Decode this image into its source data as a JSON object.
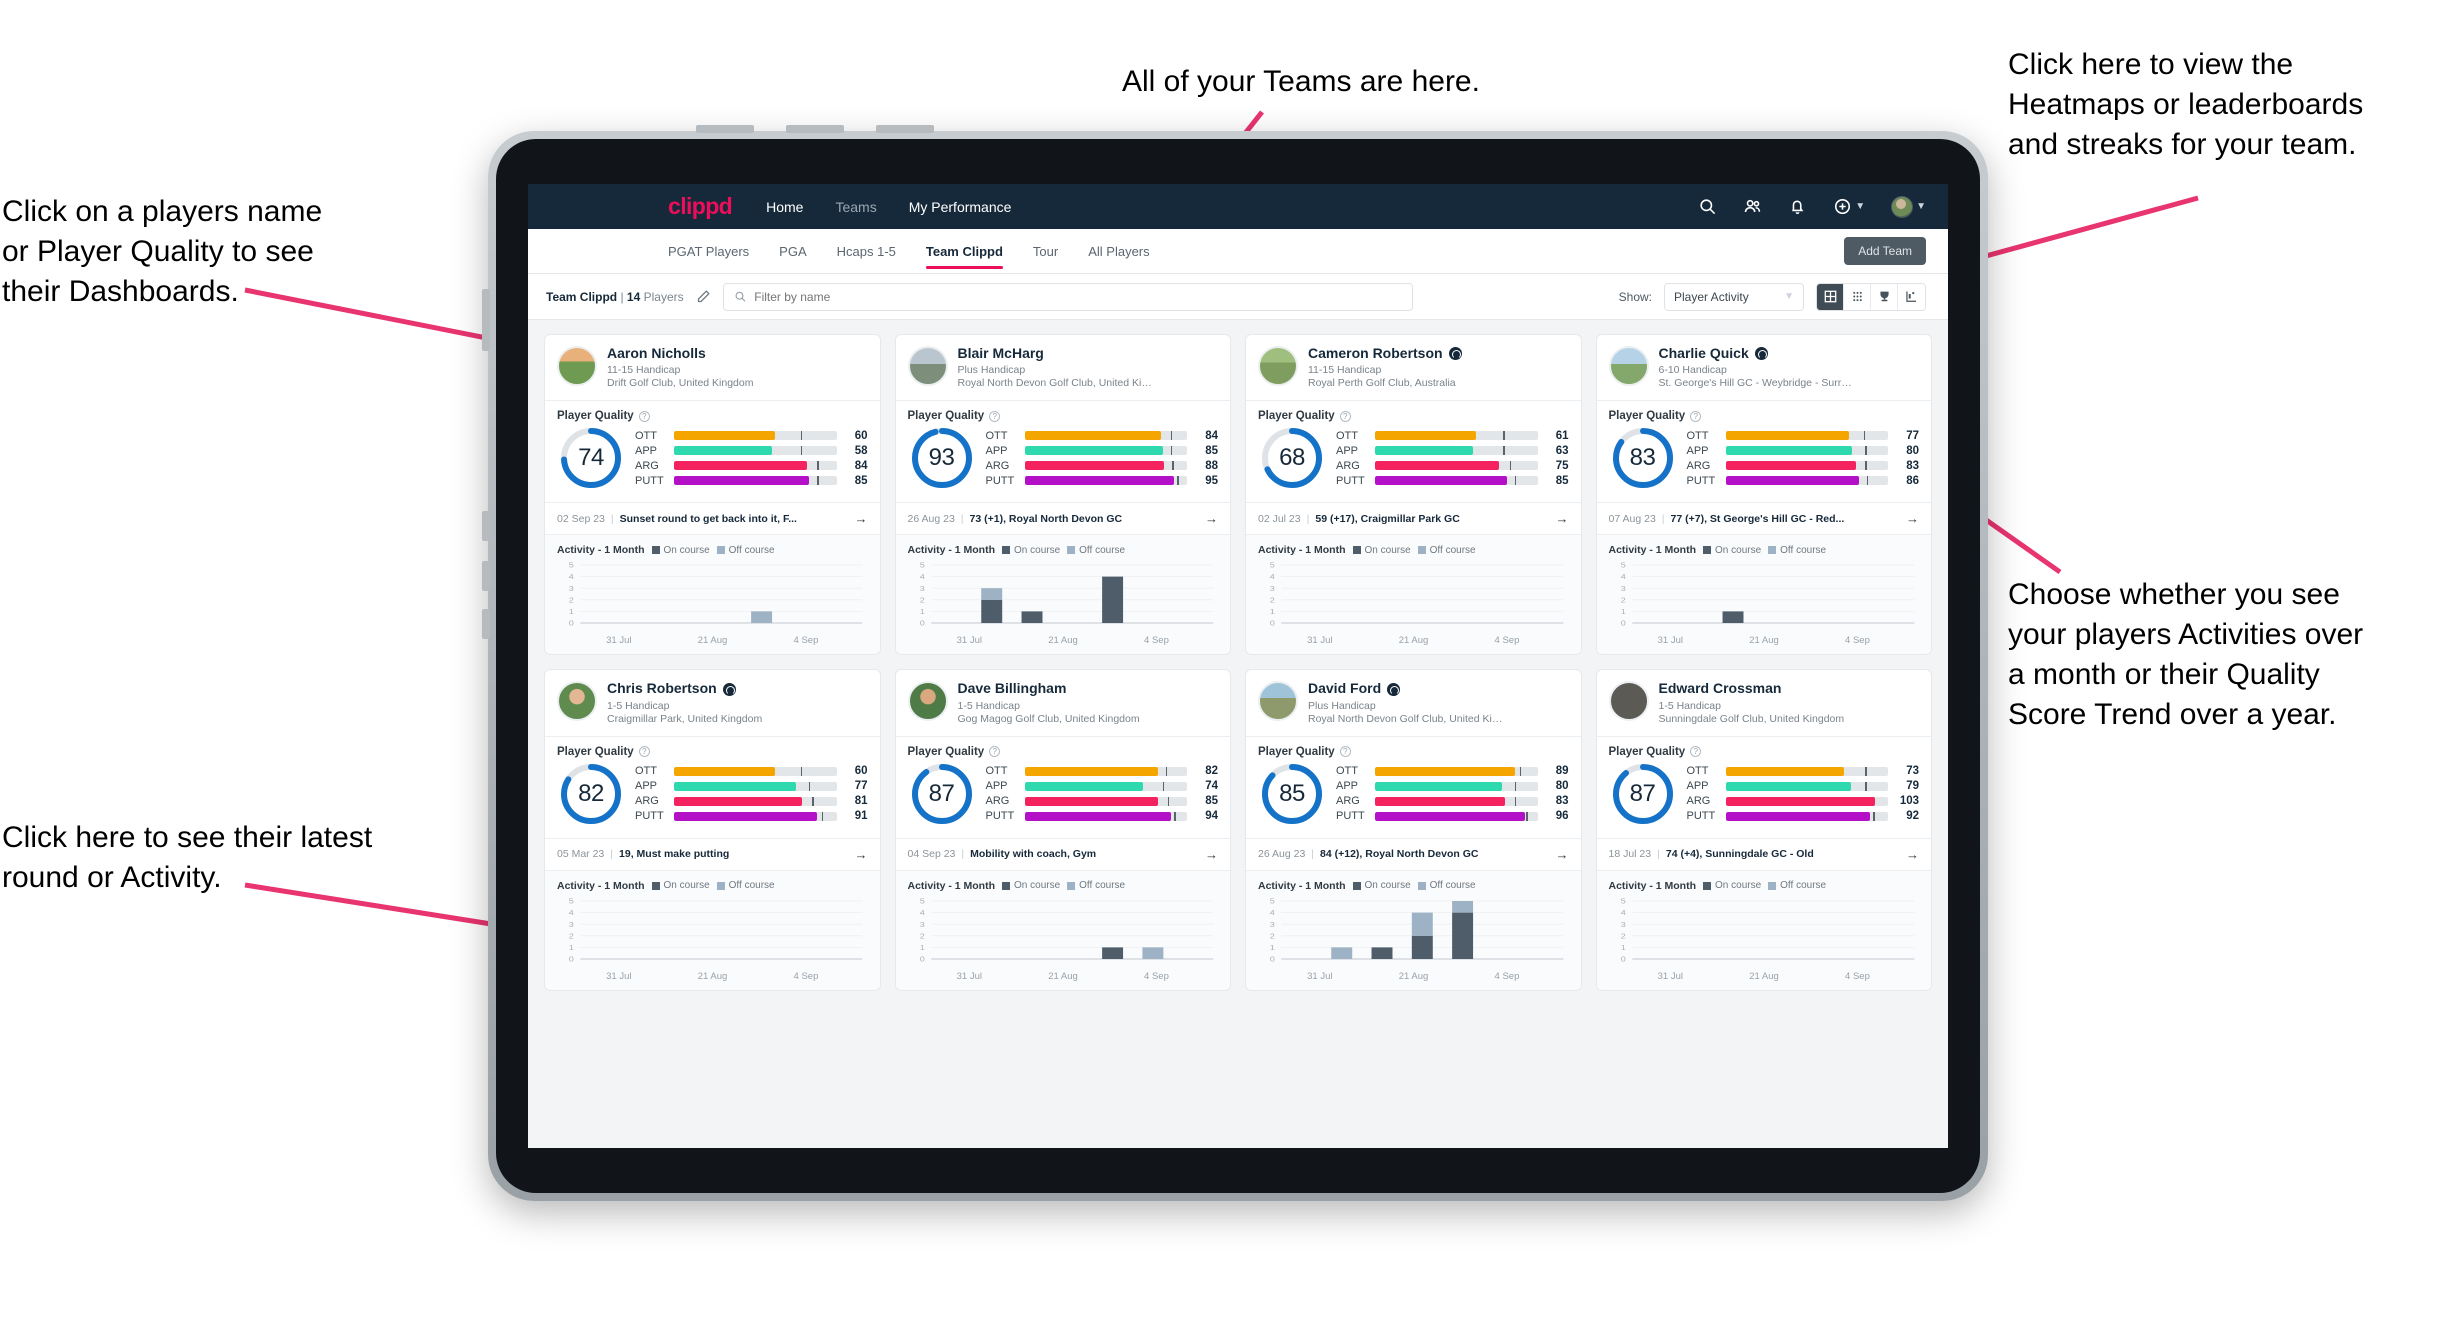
{
  "annotations": {
    "teams": "All of your Teams are here.",
    "heatmaps": "Click here to view the\nHeatmaps or leaderboards\nand streaks for your team.",
    "names": "Click on a players name\nor Player Quality to see\ntheir Dashboards.",
    "activities": "Choose whether you see\nyour players Activities over\na month or their Quality\nScore Trend over a year.",
    "latest": "Click here to see their latest\nround or Activity."
  },
  "topnav": {
    "brand": "clippd",
    "links": [
      {
        "label": "Home",
        "active": true
      },
      {
        "label": "Teams",
        "active": false
      },
      {
        "label": "My Performance",
        "active": true
      }
    ],
    "icons": [
      "search-icon",
      "people-icon",
      "bell-icon",
      "plus-circle-icon"
    ],
    "accent": "#ec0e5a",
    "bg": "#16293a"
  },
  "subnav": {
    "tabs": [
      {
        "label": "PGAT Players",
        "active": false
      },
      {
        "label": "PGA",
        "active": false
      },
      {
        "label": "Hcaps 1-5",
        "active": false
      },
      {
        "label": "Team Clippd",
        "active": true
      },
      {
        "label": "Tour",
        "active": false
      },
      {
        "label": "All Players",
        "active": false
      }
    ],
    "add_team_label": "Add Team"
  },
  "toolbar": {
    "team_name": "Team Clippd",
    "separator": " | ",
    "player_count": "14",
    "players_word": " Players",
    "search_placeholder": "Filter by name",
    "show_label": "Show:",
    "show_value": "Player Activity",
    "view_modes": [
      "grid-view-icon",
      "dots-grid-icon",
      "trophy-icon",
      "heatmap-chart-icon"
    ],
    "active_view": 0
  },
  "cards": [
    {
      "name": "Aaron Nicholls",
      "verified": false,
      "handicap": "11-15 Handicap",
      "club": "Drift Golf Club, United Kingdom",
      "quality_title": "Player Quality",
      "score": 74,
      "ring_pct": 74,
      "metrics": [
        {
          "label": "OTT",
          "value": 60,
          "fill": 62,
          "tick": 78,
          "color": "#f5a500"
        },
        {
          "label": "APP",
          "value": 58,
          "fill": 60,
          "tick": 78,
          "color": "#2ed9b0"
        },
        {
          "label": "ARG",
          "value": 84,
          "fill": 82,
          "tick": 88,
          "color": "#f4225f"
        },
        {
          "label": "PUTT",
          "value": 85,
          "fill": 83,
          "tick": 88,
          "color": "#b310c8"
        }
      ],
      "latest_date": "02 Sep 23",
      "latest_text": "Sunset round to get back into it, F...",
      "activity_title": "Activity - 1 Month",
      "legend_on": "On course",
      "legend_off": "Off course",
      "chart": {
        "on": [
          0,
          0,
          0,
          0,
          0,
          0,
          0
        ],
        "off": [
          0,
          0,
          0,
          0,
          1,
          0,
          0
        ]
      }
    },
    {
      "name": "Blair McHarg",
      "verified": false,
      "handicap": "Plus Handicap",
      "club": "Royal North Devon Golf Club, United Kin...",
      "quality_title": "Player Quality",
      "score": 93,
      "ring_pct": 96,
      "metrics": [
        {
          "label": "OTT",
          "value": 84,
          "fill": 84,
          "tick": 90,
          "color": "#f5a500"
        },
        {
          "label": "APP",
          "value": 85,
          "fill": 85,
          "tick": 90,
          "color": "#2ed9b0"
        },
        {
          "label": "ARG",
          "value": 88,
          "fill": 86,
          "tick": 91,
          "color": "#f4225f"
        },
        {
          "label": "PUTT",
          "value": 95,
          "fill": 92,
          "tick": 94,
          "color": "#b310c8"
        }
      ],
      "latest_date": "26 Aug 23",
      "latest_text": "73 (+1), Royal North Devon GC",
      "activity_title": "Activity - 1 Month",
      "legend_on": "On course",
      "legend_off": "Off course",
      "chart": {
        "on": [
          0,
          2,
          1,
          0,
          0,
          0,
          0
        ],
        "off": [
          0,
          1,
          0,
          0,
          0,
          0,
          0
        ],
        "solo_on": [
          0,
          0,
          0,
          0,
          0,
          0,
          0
        ],
        "extra": [
          {
            "idx": 4,
            "on": 4,
            "off": 0
          }
        ]
      }
    },
    {
      "name": "Cameron Robertson",
      "verified": true,
      "handicap": "11-15 Handicap",
      "club": "Royal Perth Golf Club, Australia",
      "quality_title": "Player Quality",
      "score": 68,
      "ring_pct": 68,
      "metrics": [
        {
          "label": "OTT",
          "value": 61,
          "fill": 62,
          "tick": 79,
          "color": "#f5a500"
        },
        {
          "label": "APP",
          "value": 63,
          "fill": 60,
          "tick": 79,
          "color": "#2ed9b0"
        },
        {
          "label": "ARG",
          "value": 75,
          "fill": 76,
          "tick": 83,
          "color": "#f4225f"
        },
        {
          "label": "PUTT",
          "value": 85,
          "fill": 81,
          "tick": 86,
          "color": "#b310c8"
        }
      ],
      "latest_date": "02 Jul 23",
      "latest_text": "59 (+17), Craigmillar Park GC",
      "activity_title": "Activity - 1 Month",
      "legend_on": "On course",
      "legend_off": "Off course",
      "chart": {
        "on": [
          0,
          0,
          0,
          0,
          0,
          0,
          0
        ],
        "off": [
          0,
          0,
          0,
          0,
          0,
          0,
          0
        ]
      }
    },
    {
      "name": "Charlie Quick",
      "verified": true,
      "handicap": "6-10 Handicap",
      "club": "St. George's Hill GC - Weybridge - Surrey, ...",
      "quality_title": "Player Quality",
      "score": 83,
      "ring_pct": 85,
      "metrics": [
        {
          "label": "OTT",
          "value": 77,
          "fill": 76,
          "tick": 85,
          "color": "#f5a500"
        },
        {
          "label": "APP",
          "value": 80,
          "fill": 78,
          "tick": 86,
          "color": "#2ed9b0"
        },
        {
          "label": "ARG",
          "value": 83,
          "fill": 80,
          "tick": 86,
          "color": "#f4225f"
        },
        {
          "label": "PUTT",
          "value": 86,
          "fill": 82,
          "tick": 87,
          "color": "#b310c8"
        }
      ],
      "latest_date": "07 Aug 23",
      "latest_text": "77 (+7), St George's Hill GC - Red...",
      "activity_title": "Activity - 1 Month",
      "legend_on": "On course",
      "legend_off": "Off course",
      "chart": {
        "on": [
          0,
          0,
          1,
          0,
          0,
          0,
          0
        ],
        "off": [
          0,
          0,
          0,
          0,
          0,
          0,
          0
        ]
      }
    },
    {
      "name": "Chris Robertson",
      "verified": true,
      "handicap": "1-5 Handicap",
      "club": "Craigmillar Park, United Kingdom",
      "quality_title": "Player Quality",
      "score": 82,
      "ring_pct": 84,
      "metrics": [
        {
          "label": "OTT",
          "value": 60,
          "fill": 62,
          "tick": 78,
          "color": "#f5a500"
        },
        {
          "label": "APP",
          "value": 77,
          "fill": 75,
          "tick": 83,
          "color": "#2ed9b0"
        },
        {
          "label": "ARG",
          "value": 81,
          "fill": 79,
          "tick": 85,
          "color": "#f4225f"
        },
        {
          "label": "PUTT",
          "value": 91,
          "fill": 88,
          "tick": 91,
          "color": "#b310c8"
        }
      ],
      "latest_date": "05 Mar 23",
      "latest_text": "19, Must make putting",
      "activity_title": "Activity - 1 Month",
      "legend_on": "On course",
      "legend_off": "Off course",
      "chart": {
        "on": [
          0,
          0,
          0,
          0,
          0,
          0,
          0
        ],
        "off": [
          0,
          0,
          0,
          0,
          0,
          0,
          0
        ]
      }
    },
    {
      "name": "Dave Billingham",
      "verified": false,
      "handicap": "1-5 Handicap",
      "club": "Gog Magog Golf Club, United Kingdom",
      "quality_title": "Player Quality",
      "score": 87,
      "ring_pct": 90,
      "metrics": [
        {
          "label": "OTT",
          "value": 82,
          "fill": 82,
          "tick": 87,
          "color": "#f5a500"
        },
        {
          "label": "APP",
          "value": 74,
          "fill": 73,
          "tick": 85,
          "color": "#2ed9b0"
        },
        {
          "label": "ARG",
          "value": 85,
          "fill": 82,
          "tick": 88,
          "color": "#f4225f"
        },
        {
          "label": "PUTT",
          "value": 94,
          "fill": 90,
          "tick": 92,
          "color": "#b310c8"
        }
      ],
      "latest_date": "04 Sep 23",
      "latest_text": "Mobility with coach, Gym",
      "activity_title": "Activity - 1 Month",
      "legend_on": "On course",
      "legend_off": "Off course",
      "chart": {
        "on": [
          0,
          0,
          0,
          0,
          1,
          0,
          0
        ],
        "off": [
          0,
          0,
          0,
          0,
          0,
          1,
          0
        ]
      }
    },
    {
      "name": "David Ford",
      "verified": true,
      "handicap": "Plus Handicap",
      "club": "Royal North Devon Golf Club, United Kin...",
      "quality_title": "Player Quality",
      "score": 85,
      "ring_pct": 87,
      "metrics": [
        {
          "label": "OTT",
          "value": 89,
          "fill": 86,
          "tick": 89,
          "color": "#f5a500"
        },
        {
          "label": "APP",
          "value": 80,
          "fill": 78,
          "tick": 86,
          "color": "#2ed9b0"
        },
        {
          "label": "ARG",
          "value": 83,
          "fill": 80,
          "tick": 86,
          "color": "#f4225f"
        },
        {
          "label": "PUTT",
          "value": 96,
          "fill": 92,
          "tick": 93,
          "color": "#b310c8"
        }
      ],
      "latest_date": "26 Aug 23",
      "latest_text": "84 (+12), Royal North Devon GC",
      "activity_title": "Activity - 1 Month",
      "legend_on": "On course",
      "legend_off": "Off course",
      "chart": {
        "on": [
          0,
          0,
          1,
          2,
          4,
          0,
          0
        ],
        "off": [
          0,
          1,
          0,
          2,
          1,
          0,
          0
        ]
      }
    },
    {
      "name": "Edward Crossman",
      "verified": false,
      "handicap": "1-5 Handicap",
      "club": "Sunningdale Golf Club, United Kingdom",
      "quality_title": "Player Quality",
      "score": 87,
      "ring_pct": 89,
      "metrics": [
        {
          "label": "OTT",
          "value": 73,
          "fill": 73,
          "tick": 86,
          "color": "#f5a500"
        },
        {
          "label": "APP",
          "value": 79,
          "fill": 77,
          "tick": 86,
          "color": "#2ed9b0"
        },
        {
          "label": "ARG",
          "value": 103,
          "fill": 92,
          "tick": 0,
          "color": "#f4225f"
        },
        {
          "label": "PUTT",
          "value": 92,
          "fill": 89,
          "tick": 91,
          "color": "#b310c8"
        }
      ],
      "latest_date": "18 Jul 23",
      "latest_text": "74 (+4), Sunningdale GC - Old",
      "activity_title": "Activity - 1 Month",
      "legend_on": "On course",
      "legend_off": "Off course",
      "chart": {
        "on": [
          0,
          0,
          0,
          0,
          0,
          0,
          0
        ],
        "off": [
          0,
          0,
          0,
          0,
          0,
          0,
          0
        ]
      }
    }
  ],
  "chart_axis": {
    "yticks": [
      "5",
      "4",
      "3",
      "2",
      "1",
      "0"
    ],
    "xticks": [
      "31 Jul",
      "21 Aug",
      "4 Sep"
    ],
    "ymax": 5
  },
  "colors": {
    "accent": "#ec0e5a",
    "navy": "#16293a",
    "arrow": "#e8346f"
  }
}
